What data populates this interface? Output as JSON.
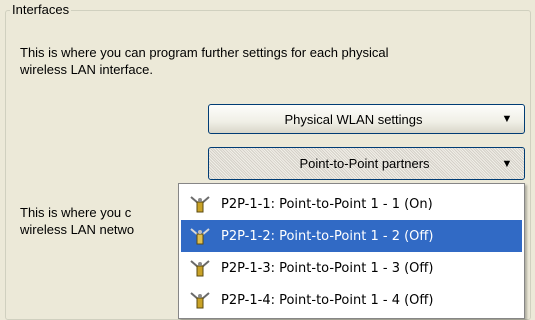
{
  "group": {
    "title": "Interfaces"
  },
  "descriptions": {
    "physical": "This is where you can program further settings for each physical\nwireless LAN interface.",
    "logical": "This is where you c\nwireless LAN netwo"
  },
  "buttons": {
    "physical_wlan": {
      "label": "Physical WLAN settings",
      "icon": "chevron-down-icon"
    },
    "p2p_partners": {
      "label": "Point-to-Point partners",
      "icon": "chevron-down-icon"
    }
  },
  "menu": {
    "items": [
      {
        "label": "P2P-1-1: Point-to-Point 1 - 1 (On)",
        "icon": "antenna-icon",
        "selected": false
      },
      {
        "label": "P2P-1-2: Point-to-Point 1 - 2 (Off)",
        "icon": "antenna-icon",
        "selected": true
      },
      {
        "label": "P2P-1-3: Point-to-Point 1 - 3 (Off)",
        "icon": "antenna-icon",
        "selected": false
      },
      {
        "label": "P2P-1-4: Point-to-Point 1 - 4 (Off)",
        "icon": "antenna-icon",
        "selected": false
      }
    ]
  },
  "colors": {
    "selection": "#316ac5",
    "window_bg": "#ece9d8",
    "button_border": "#003c74"
  }
}
